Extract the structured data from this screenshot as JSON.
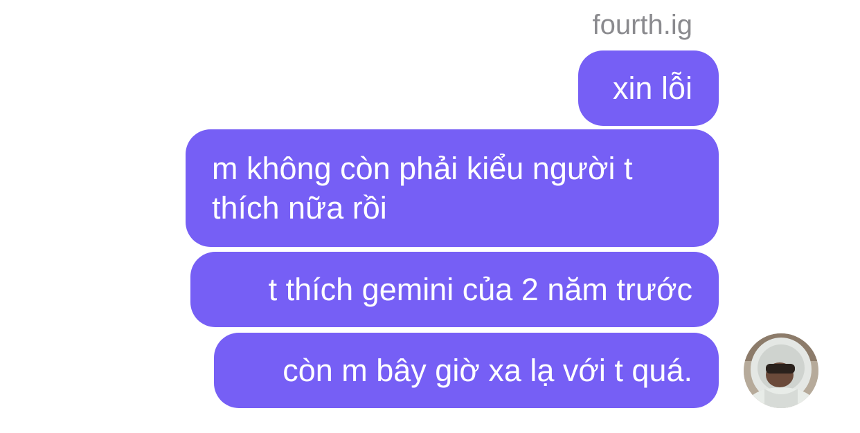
{
  "chat": {
    "sender_name": "fourth.ig",
    "messages": [
      {
        "text": "xin lỗi"
      },
      {
        "text": "m không còn phải kiểu người t thích nữa rồi"
      },
      {
        "text": "t thích gemini của 2 năm trước"
      },
      {
        "text": "còn m bây giờ xa lạ với t quá."
      }
    ],
    "bubble_color": "#765ff5",
    "text_color": "#ffffff",
    "name_color": "#8a8a8e",
    "avatar_icon": "user-photo-avatar"
  }
}
